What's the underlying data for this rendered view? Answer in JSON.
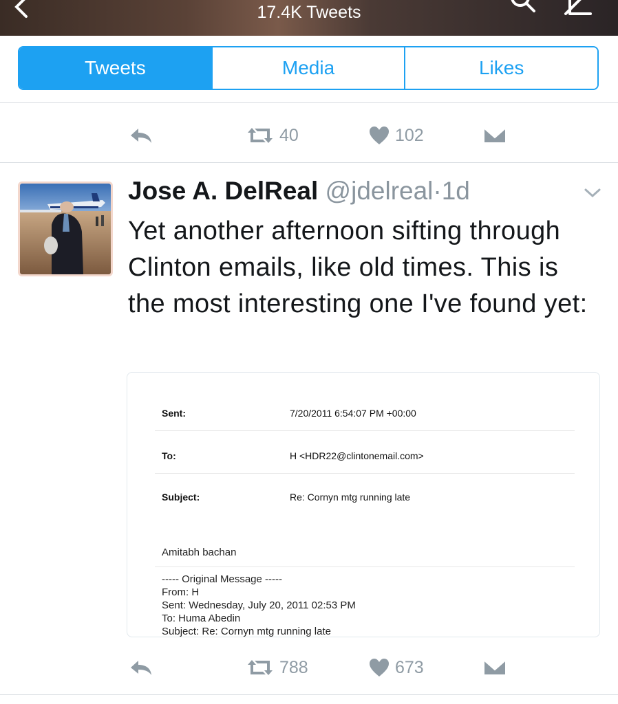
{
  "header": {
    "tweet_count": "17.4K Tweets",
    "back_icon": "back-chevron-icon",
    "search_icon": "search-icon",
    "compose_icon": "compose-tweet-icon"
  },
  "tabs": [
    {
      "label": "Tweets",
      "active": true
    },
    {
      "label": "Media",
      "active": false
    },
    {
      "label": "Likes",
      "active": false
    }
  ],
  "prev_tweet_actions": {
    "retweets": "40",
    "likes": "102"
  },
  "tweet": {
    "author_name": "Jose A. DelReal",
    "handle": "@jdelreal",
    "separator": "·",
    "time": "1d",
    "text": "Yet another afternoon sifting through Clinton emails, like old times. This is the most interesting one I've found yet:",
    "email_image": {
      "sent_label": "Sent:",
      "sent_value": "7/20/2011 6:54:07 PM +00:00",
      "to_label": "To:",
      "to_value": "H <HDR22@clintonemail.com>",
      "subject_label": "Subject:",
      "subject_value": "Re: Cornyn mtg running late",
      "body": "Amitabh bachan",
      "original_header": "----- Original Message -----",
      "orig_from": "From: H",
      "orig_sent": "Sent: Wednesday, July 20, 2011 02:53 PM",
      "orig_to": "To: Huma Abedin",
      "orig_subject": "Subject: Re: Cornyn mtg running late"
    },
    "actions": {
      "retweets": "788",
      "likes": "673"
    }
  },
  "colors": {
    "accent": "#1da1f2",
    "icon_gray": "#8f9ba4",
    "text": "#14171a"
  }
}
